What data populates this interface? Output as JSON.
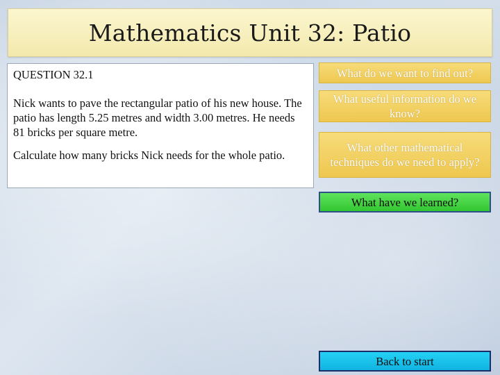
{
  "slide": {
    "title": "Mathematics Unit 32: Patio"
  },
  "question": {
    "heading": "QUESTION 32.1",
    "body": "Nick wants to pave the rectangular patio of his new house.  The patio has length 5.25 metres and width 3.00 metres.  He needs 81 bricks per square metre.",
    "task": "Calculate how many bricks Nick needs for the whole patio."
  },
  "buttons": {
    "find_out": "What do we want to find out?",
    "useful_info": "What useful information do we know?",
    "techniques": "What other mathematical techniques do we need to apply?",
    "learned": "What have we learned?",
    "back_to_start": "Back to start"
  },
  "colors": {
    "title_bg": "#f3e9ad",
    "gold_button": "#eec74f",
    "green_button": "#33c631",
    "blue_button": "#10b3e0",
    "button_border": "#2f4f8c"
  }
}
